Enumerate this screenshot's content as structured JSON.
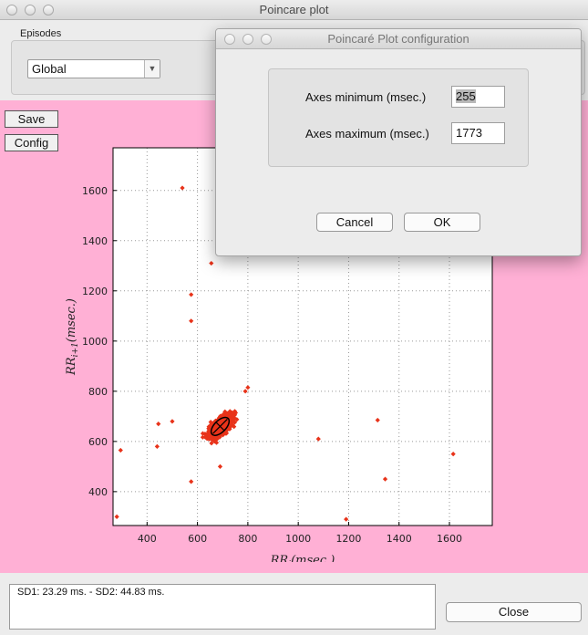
{
  "window": {
    "title": "Poincare plot"
  },
  "episodes": {
    "label": "Episodes",
    "selected": "Global"
  },
  "buttons": {
    "save": "Save",
    "config": "Config",
    "close": "Close"
  },
  "result": {
    "text": "SD1: 23.29 ms. - SD2: 44.83 ms."
  },
  "dialog": {
    "title": "Poincaré Plot configuration",
    "axes_min_label": "Axes minimum (msec.)",
    "axes_min_value": "255",
    "axes_max_label": "Axes maximum (msec.)",
    "axes_max_value": "1773",
    "cancel": "Cancel",
    "ok": "OK"
  },
  "chart_data": {
    "type": "scatter",
    "title": "",
    "xlabel": "RR_i (msec.)",
    "ylabel": "RR_{i+1} (msec.)",
    "xlim": [
      265,
      1770
    ],
    "ylim": [
      265,
      1770
    ],
    "xticks": [
      400,
      600,
      800,
      1000,
      1200,
      1400,
      1600
    ],
    "yticks": [
      400,
      600,
      800,
      1000,
      1200,
      1400,
      1600
    ],
    "grid": true,
    "marker_color": "#e8331a",
    "cluster": {
      "center": [
        690,
        660
      ],
      "sd1": 23.29,
      "sd2": 44.83,
      "angle_deg": 45
    },
    "outliers": [
      [
        540,
        1610
      ],
      [
        655,
        1310
      ],
      [
        575,
        1185
      ],
      [
        575,
        1080
      ],
      [
        500,
        680
      ],
      [
        445,
        670
      ],
      [
        440,
        580
      ],
      [
        295,
        565
      ],
      [
        280,
        300
      ],
      [
        575,
        440
      ],
      [
        690,
        500
      ],
      [
        1080,
        610
      ],
      [
        1315,
        685
      ],
      [
        1345,
        450
      ],
      [
        1615,
        550
      ],
      [
        1190,
        290
      ],
      [
        800,
        815
      ],
      [
        790,
        800
      ]
    ],
    "sd_ellipse": {
      "center": [
        690,
        660
      ],
      "rx": 44.83,
      "ry": 23.29,
      "angle_deg": 45,
      "color": "#000000"
    }
  }
}
